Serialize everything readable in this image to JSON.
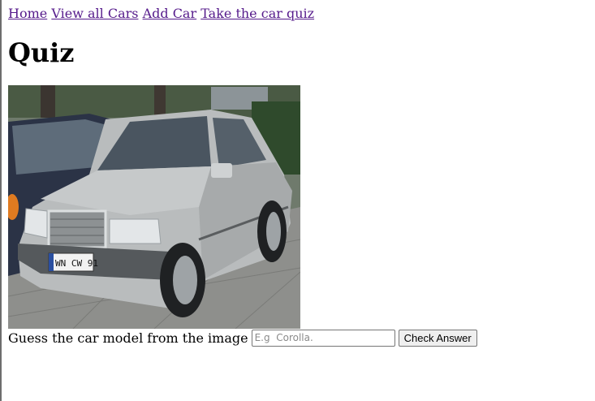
{
  "nav": {
    "links": [
      "Home",
      "View all Cars",
      "Add Car",
      "Take the car quiz"
    ]
  },
  "heading": "Quiz",
  "car_image": {
    "alt": "car image",
    "plate_text": "WN CW 91"
  },
  "quiz": {
    "prompt": "Guess the car model from the image",
    "input_value": "",
    "input_placeholder": "E.g  Corolla.",
    "button_label": "Check Answer"
  },
  "colors": {
    "link": "#551a8b",
    "car_body": "#b9bcbd",
    "background": "#ffffff"
  }
}
